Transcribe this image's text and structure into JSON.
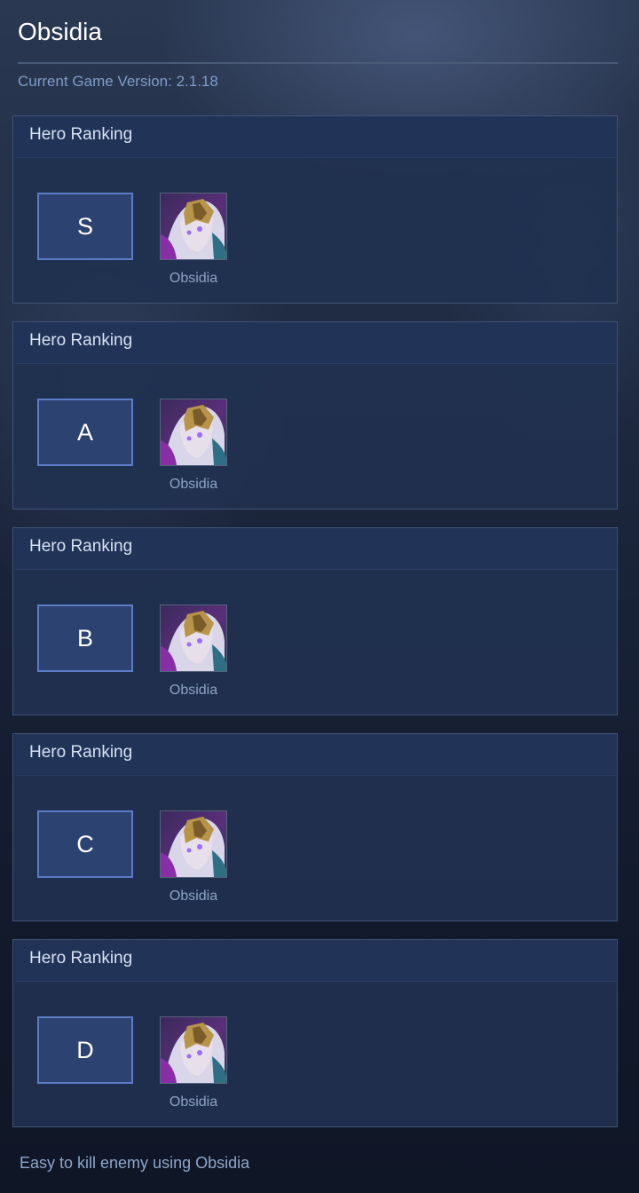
{
  "app": {
    "title": "Obsidia",
    "version_text": "Current Game Version: 2.1.18"
  },
  "rankings": [
    {
      "header": "Hero Ranking",
      "tier": "S",
      "hero_name": "Obsidia",
      "hero_icon": "obsidia-portrait-icon"
    },
    {
      "header": "Hero Ranking",
      "tier": "A",
      "hero_name": "Obsidia",
      "hero_icon": "obsidia-portrait-icon"
    },
    {
      "header": "Hero Ranking",
      "tier": "B",
      "hero_name": "Obsidia",
      "hero_icon": "obsidia-portrait-icon"
    },
    {
      "header": "Hero Ranking",
      "tier": "C",
      "hero_name": "Obsidia",
      "hero_icon": "obsidia-portrait-icon"
    },
    {
      "header": "Hero Ranking",
      "tier": "D",
      "hero_name": "Obsidia",
      "hero_icon": "obsidia-portrait-icon"
    }
  ],
  "footer": {
    "note": "Easy to kill enemy using Obsidia"
  },
  "colors": {
    "accent": "#5b7cc7",
    "card_background": "#203050",
    "version_text": "#7f9cc8"
  }
}
